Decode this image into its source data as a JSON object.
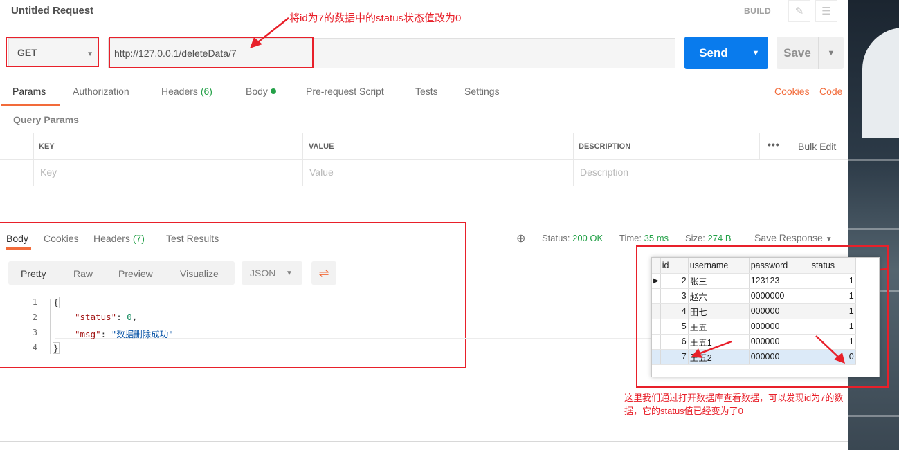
{
  "request": {
    "title": "Untitled Request",
    "build_label": "BUILD",
    "method": "GET",
    "url": "http://127.0.0.1/deleteData/7",
    "send_label": "Send",
    "save_label": "Save"
  },
  "annotations": {
    "top": "将id为7的数据中的status状态值改为0",
    "bottom": "这里我们通过打开数据库查看数据，可以发现id为7的数据，它的status值已经变为了0"
  },
  "request_tabs": [
    {
      "label": "Params"
    },
    {
      "label": "Authorization"
    },
    {
      "label": "Headers",
      "count": "(6)"
    },
    {
      "label": "Body"
    },
    {
      "label": "Pre-request Script"
    },
    {
      "label": "Tests"
    },
    {
      "label": "Settings"
    }
  ],
  "links": {
    "cookies": "Cookies",
    "code": "Code",
    "bulk_edit": "Bulk Edit"
  },
  "params": {
    "section_title": "Query Params",
    "headers": [
      "KEY",
      "VALUE",
      "DESCRIPTION"
    ],
    "placeholders": [
      "Key",
      "Value",
      "Description"
    ]
  },
  "response": {
    "tabs": [
      {
        "label": "Body"
      },
      {
        "label": "Cookies"
      },
      {
        "label": "Headers",
        "count": "(7)"
      },
      {
        "label": "Test Results"
      }
    ],
    "status_label": "Status:",
    "status_value": "200 OK",
    "time_label": "Time:",
    "time_value": "35 ms",
    "size_label": "Size:",
    "size_value": "274 B",
    "save_response": "Save Response",
    "formats": [
      "Pretty",
      "Raw",
      "Preview",
      "Visualize"
    ],
    "language": "JSON",
    "code_lines": [
      "1",
      "2",
      "3",
      "4"
    ],
    "json": {
      "open": "{",
      "status_key": "\"status\"",
      "status_val": "0",
      "msg_key": "\"msg\"",
      "msg_val": "\"数据删除成功\"",
      "close": "}"
    }
  },
  "db_table": {
    "columns": [
      "id",
      "username",
      "password",
      "status"
    ],
    "rows": [
      {
        "id": "2",
        "username": "张三",
        "password": "123123",
        "status": "1"
      },
      {
        "id": "3",
        "username": "赵六",
        "password": "0000000",
        "status": "1"
      },
      {
        "id": "4",
        "username": "田七",
        "password": "000000",
        "status": "1"
      },
      {
        "id": "5",
        "username": "王五",
        "password": "000000",
        "status": "1"
      },
      {
        "id": "6",
        "username": "王五1",
        "password": "000000",
        "status": "1"
      },
      {
        "id": "7",
        "username": "王五2",
        "password": "000000",
        "status": "0"
      }
    ]
  },
  "colors": {
    "accent": "#f26b3a",
    "send": "#097bed",
    "annotation": "#e8202a",
    "success": "#24a148"
  }
}
